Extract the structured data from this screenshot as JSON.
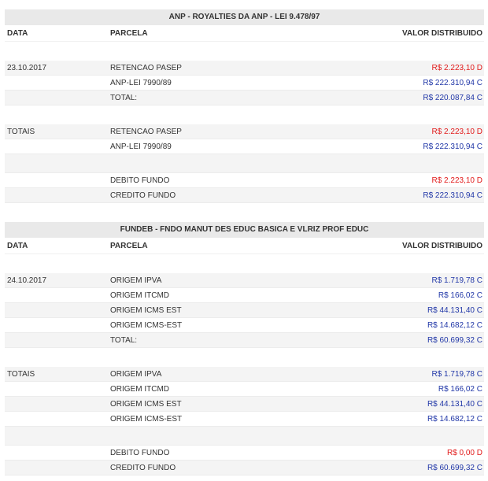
{
  "sections": [
    {
      "title": "ANP - ROYALTIES DA ANP - LEI 9.478/97",
      "header": {
        "date": "DATA",
        "parcela": "PARCELA",
        "valor": "VALOR DISTRIBUIDO"
      },
      "rows": [
        {
          "date": "23.10.2017",
          "parcela": "RETENCAO PASEP",
          "valor": "R$ 2.223,10 D",
          "tone": "red"
        },
        {
          "date": "",
          "parcela": "ANP-LEI 7990/89",
          "valor": "R$ 222.310,94 C",
          "tone": "blue"
        },
        {
          "date": "",
          "parcela": "TOTAL:",
          "valor": "R$ 220.087,84 C",
          "tone": "blue"
        }
      ],
      "totais": [
        {
          "date": "TOTAIS",
          "parcela": "RETENCAO PASEP",
          "valor": "R$ 2.223,10 D",
          "tone": "red"
        },
        {
          "date": "",
          "parcela": "ANP-LEI 7990/89",
          "valor": "R$ 222.310,94 C",
          "tone": "blue"
        }
      ],
      "fundo": [
        {
          "parcela": "DEBITO FUNDO",
          "valor": "R$ 2.223,10 D",
          "tone": "red"
        },
        {
          "parcela": "CREDITO FUNDO",
          "valor": "R$ 222.310,94 C",
          "tone": "blue"
        }
      ]
    },
    {
      "title": "FUNDEB - FNDO MANUT DES EDUC BASICA E VLRIZ PROF EDUC",
      "header": {
        "date": "DATA",
        "parcela": "PARCELA",
        "valor": "VALOR DISTRIBUIDO"
      },
      "rows": [
        {
          "date": "24.10.2017",
          "parcela": "ORIGEM IPVA",
          "valor": "R$ 1.719,78 C",
          "tone": "blue"
        },
        {
          "date": "",
          "parcela": "ORIGEM ITCMD",
          "valor": "R$ 166,02 C",
          "tone": "blue"
        },
        {
          "date": "",
          "parcela": "ORIGEM ICMS EST",
          "valor": "R$ 44.131,40 C",
          "tone": "blue"
        },
        {
          "date": "",
          "parcela": "ORIGEM ICMS-EST",
          "valor": "R$ 14.682,12 C",
          "tone": "blue"
        },
        {
          "date": "",
          "parcela": "TOTAL:",
          "valor": "R$ 60.699,32 C",
          "tone": "blue"
        }
      ],
      "totais": [
        {
          "date": "TOTAIS",
          "parcela": "ORIGEM IPVA",
          "valor": "R$ 1.719,78 C",
          "tone": "blue"
        },
        {
          "date": "",
          "parcela": "ORIGEM ITCMD",
          "valor": "R$ 166,02 C",
          "tone": "blue"
        },
        {
          "date": "",
          "parcela": "ORIGEM ICMS EST",
          "valor": "R$ 44.131,40 C",
          "tone": "blue"
        },
        {
          "date": "",
          "parcela": "ORIGEM ICMS-EST",
          "valor": "R$ 14.682,12 C",
          "tone": "blue"
        }
      ],
      "fundo": [
        {
          "parcela": "DEBITO FUNDO",
          "valor": "R$ 0,00 D",
          "tone": "red"
        },
        {
          "parcela": "CREDITO FUNDO",
          "valor": "R$ 60.699,32 C",
          "tone": "blue"
        }
      ]
    }
  ]
}
